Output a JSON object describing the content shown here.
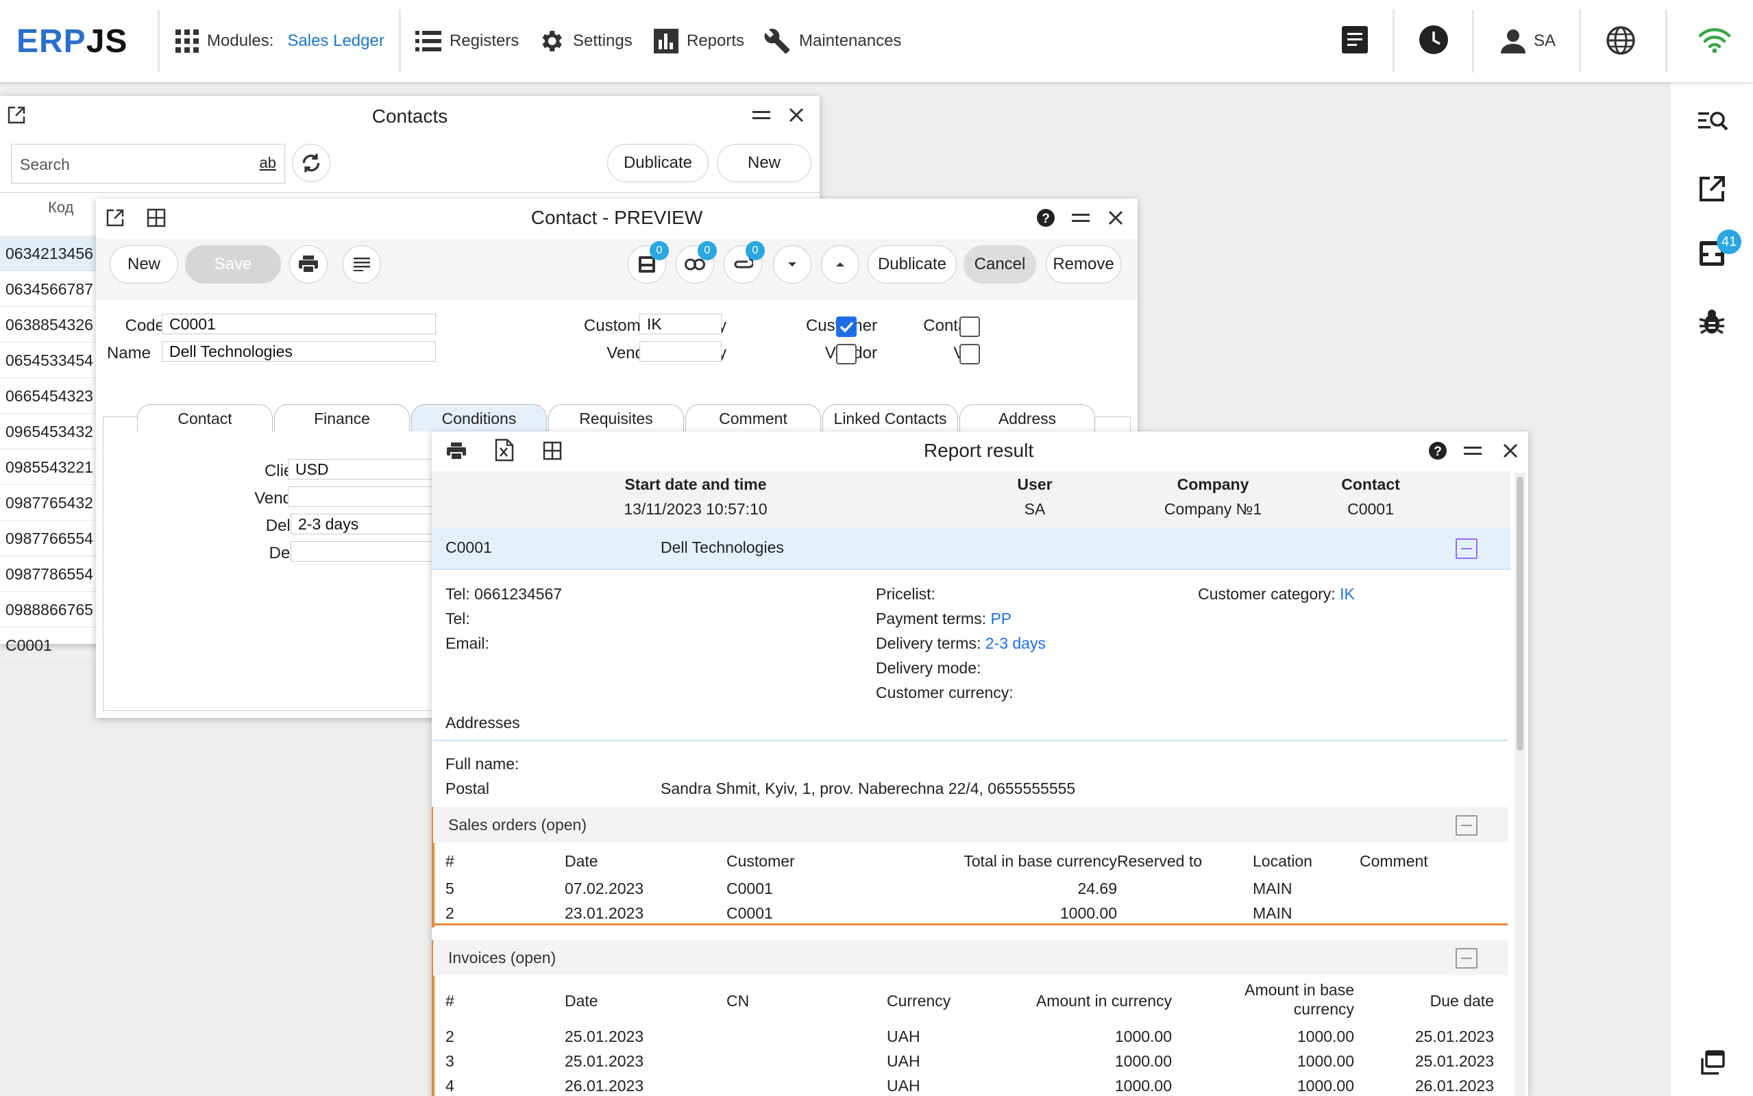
{
  "topbar": {
    "logo_a": "ERP",
    "logo_b": "JS",
    "modules_label": "Modules:",
    "modules_value": "Sales Ledger",
    "registers": "Registers",
    "settings": "Settings",
    "reports": "Reports",
    "maintenances": "Maintenances",
    "user": "SA"
  },
  "sidebar": {
    "badge": "41"
  },
  "contacts": {
    "title": "Contacts",
    "search_placeholder": "Search",
    "duplicate": "Dublicate",
    "new": "New",
    "column": "Код",
    "codes": [
      "0634213456",
      "0634566787",
      "0638854326",
      "0654533454",
      "0665454323",
      "0965453432",
      "0985543221",
      "0987765432",
      "0987766554",
      "0987786554",
      "0988866765",
      "C0001"
    ]
  },
  "preview": {
    "title": "Contact - PREVIEW",
    "new": "New",
    "save": "Save",
    "duplicate": "Dublicate",
    "cancel": "Cancel",
    "remove": "Remove",
    "badges": [
      "0",
      "0",
      "0"
    ],
    "code_label": "Code",
    "code_value": "C0001",
    "name_label": "Name",
    "name_value": "Dell Technologies",
    "customer_category_label": "Customer Category",
    "customer_category_value": "IK",
    "vendor_category_label": "Vendor category",
    "vendor_category_value": "",
    "customer_label": "Customer",
    "vendor_label": "Vendor",
    "contact_label": "Contact",
    "vip_label": "VIP",
    "tabs": [
      "Contact",
      "Finance",
      "Conditions",
      "Requisites",
      "Comment",
      "Linked Contacts",
      "Address"
    ],
    "client_currency_label": "Client currency",
    "client_currency_value": "USD",
    "vendor_currency_label": "Vendor currency",
    "vendor_currency_value": "",
    "delivery_terms_label": "Delivery Terms",
    "delivery_terms_value": "2-3 days",
    "delivery_mode_label": "Delivery Mode",
    "delivery_mode_value": ""
  },
  "report": {
    "title": "Report result",
    "headers": {
      "start_label": "Start date and time",
      "start_value": "13/11/2023 10:57:10",
      "user_label": "User",
      "user_value": "SA",
      "company_label": "Company",
      "company_value": "Company №1",
      "contact_label": "Contact",
      "contact_value": "C0001"
    },
    "contact_code": "C0001",
    "contact_name": "Dell Technologies",
    "tel1": "Tel: 0661234567",
    "tel2": "Tel:",
    "email": "Email:",
    "pricelist": "Pricelist:",
    "payment_terms_label": "Payment terms:",
    "payment_terms_value": "PP",
    "delivery_terms_label": "Delivery terms:",
    "delivery_terms_value": "2-3 days",
    "delivery_mode": "Delivery mode:",
    "customer_currency": "Customer currency:",
    "customer_category_label": "Customer category:",
    "customer_category_value": "IK",
    "addresses_title": "Addresses",
    "full_name": "Full name:",
    "postal_label": "Postal",
    "postal_value": "Sandra Shmit, Kyiv, 1, prov. Naberechna 22/4, 0655555555",
    "sales_orders": {
      "title": "Sales orders (open)",
      "columns": [
        "#",
        "Date",
        "Customer",
        "Total in base currency",
        "Reserved to",
        "Location",
        "Comment"
      ],
      "rows": [
        {
          "num": "5",
          "date": "07.02.2023",
          "customer": "C0001",
          "total": "24.69",
          "reserved": "",
          "location": "MAIN",
          "comment": ""
        },
        {
          "num": "2",
          "date": "23.01.2023",
          "customer": "C0001",
          "total": "1000.00",
          "reserved": "",
          "location": "MAIN",
          "comment": ""
        }
      ]
    },
    "invoices": {
      "title": "Invoices (open)",
      "columns": [
        "#",
        "Date",
        "CN",
        "Currency",
        "Amount in currency",
        "Amount in base",
        "currency",
        "Due date"
      ],
      "rows": [
        {
          "num": "2",
          "date": "25.01.2023",
          "cn": "",
          "currency": "UAH",
          "amount": "1000.00",
          "base": "1000.00",
          "due": "25.01.2023"
        },
        {
          "num": "3",
          "date": "25.01.2023",
          "cn": "",
          "currency": "UAH",
          "amount": "1000.00",
          "base": "1000.00",
          "due": "25.01.2023"
        },
        {
          "num": "4",
          "date": "26.01.2023",
          "cn": "",
          "currency": "UAH",
          "amount": "1000.00",
          "base": "1000.00",
          "due": "26.01.2023"
        }
      ]
    }
  }
}
